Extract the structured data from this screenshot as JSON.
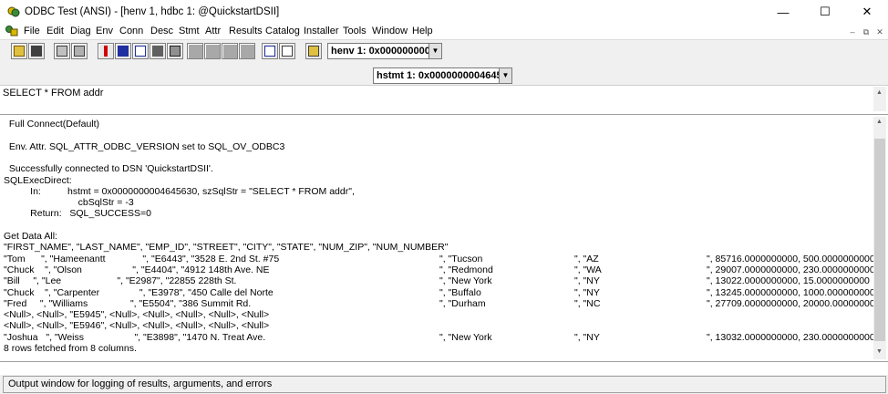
{
  "window": {
    "title": "ODBC Test (ANSI) - [henv 1, hdbc 1: @QuickstartDSII]",
    "minimize": "—",
    "maximize": "☐",
    "close": "✕"
  },
  "menu": {
    "items": [
      "File",
      "Edit",
      "Diag",
      "Env",
      "Conn",
      "Desc",
      "Stmt",
      "Attr",
      "Results",
      "Catalog",
      "Installer",
      "Tools",
      "Window",
      "Help"
    ],
    "mdi_minimize": "–",
    "mdi_restore": "⧉",
    "mdi_close": "✕"
  },
  "toolbar": {
    "henv_combo": "henv 1:  0x000000000",
    "hstmt_combo": "hstmt 1:  0x0000000004645"
  },
  "sql_input": {
    "value": "SELECT * FROM addr"
  },
  "output": {
    "lines": [
      "  Full Connect(Default)",
      "",
      "  Env. Attr. SQL_ATTR_ODBC_VERSION set to SQL_OV_ODBC3",
      "",
      "  Successfully connected to DSN 'QuickstartDSII'.",
      "SQLExecDirect:",
      "          In:          hstmt = 0x0000000004645630, szSqlStr = \"SELECT * FROM addr\",",
      "                            cbSqlStr = -3",
      "          Return:   SQL_SUCCESS=0",
      "",
      "Get Data All:",
      "\"FIRST_NAME\", \"LAST_NAME\", \"EMP_ID\", \"STREET\", \"CITY\", \"STATE\", \"NUM_ZIP\", \"NUM_NUMBER\""
    ],
    "rows": [
      {
        "a": "\"Tom      \", \"Hameenantt              \", \"E6443\", \"3528 E. 2nd St. #75",
        "b": "\", \"Tucson",
        "c": "\", \"AZ",
        "d": "\", 85716.0000000000, 500.0000000000"
      },
      {
        "a": "\"Chuck    \", \"Olson                   \", \"E4404\", \"4912 148th Ave. NE",
        "b": "\", \"Redmond",
        "c": "\", \"WA",
        "d": "\", 29007.0000000000, 230.0000000000"
      },
      {
        "a": "\"Bill     \", \"Lee                     \", \"E2987\", \"22855 228th St.",
        "b": "\", \"New York",
        "c": "\", \"NY",
        "d": "\", 13022.0000000000, 15.0000000000"
      },
      {
        "a": "\"Chuck    \", \"Carpenter               \", \"E3978\", \"450 Calle del Norte",
        "b": "\", \"Buffalo",
        "c": "\", \"NY",
        "d": "\", 13245.0000000000, 1000.0000000000"
      },
      {
        "a": "\"Fred     \", \"Williams                \", \"E5504\", \"386 Summit Rd.",
        "b": "\", \"Durham",
        "c": "\", \"NC",
        "d": "\", 27709.0000000000, 20000.0000000000"
      },
      {
        "a": "<Null>, <Null>, \"E5945\", <Null>, <Null>, <Null>, <Null>, <Null>",
        "b": "",
        "c": "",
        "d": ""
      },
      {
        "a": "<Null>, <Null>, \"E5946\", <Null>, <Null>, <Null>, <Null>, <Null>",
        "b": "",
        "c": "",
        "d": ""
      },
      {
        "a": "\"Joshua   \", \"Weiss                   \", \"E3898\", \"1470 N. Treat Ave.",
        "b": "\", \"New York",
        "c": "\", \"NY",
        "d": "\", 13032.0000000000, 230.0000000000"
      }
    ],
    "summary": "8 rows fetched from 8 columns."
  },
  "status": {
    "text": "Output window for logging of results, arguments, and errors"
  }
}
